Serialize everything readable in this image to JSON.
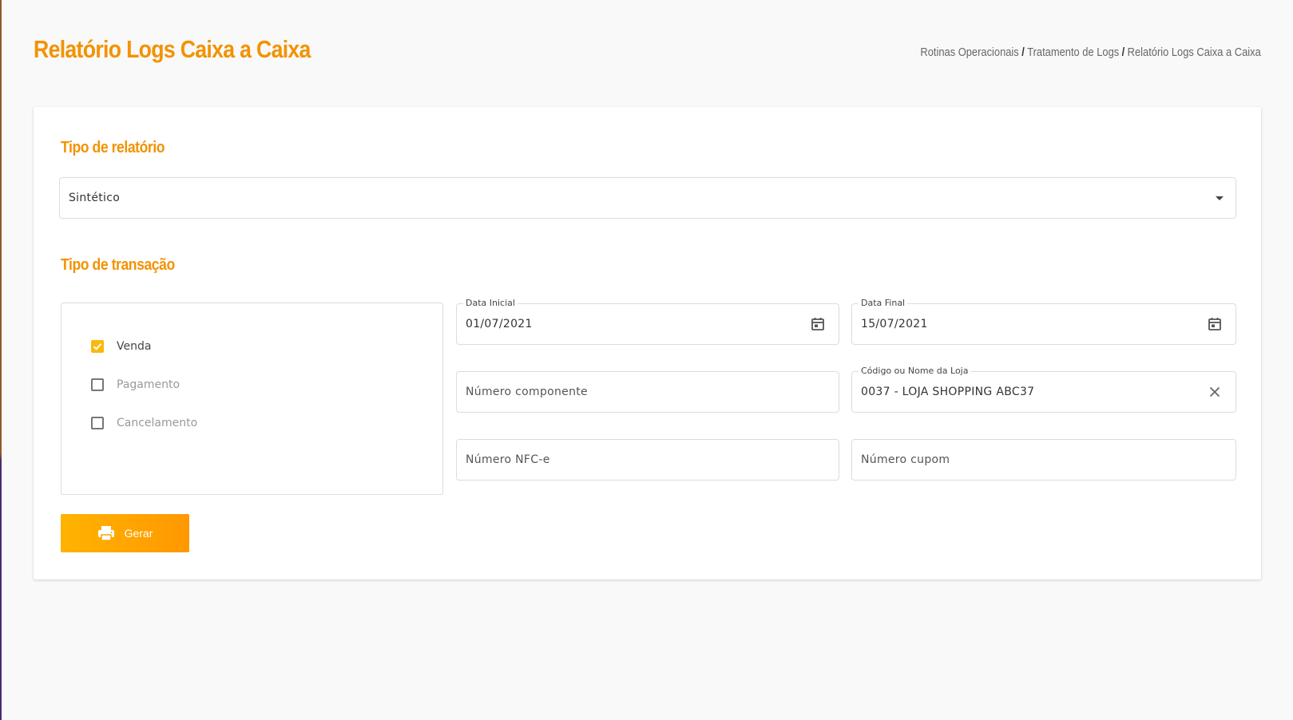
{
  "header": {
    "title": "Relatório Logs Caixa a Caixa",
    "breadcrumb": [
      "Rotinas Operacionais",
      "Tratamento de Logs",
      "Relatório Logs Caixa a Caixa"
    ]
  },
  "report_type": {
    "section_title": "Tipo de relatório",
    "selected": "Sintético"
  },
  "transaction_type": {
    "section_title": "Tipo de transação",
    "options": [
      {
        "label": "Venda",
        "checked": true
      },
      {
        "label": "Pagamento",
        "checked": false
      },
      {
        "label": "Cancelamento",
        "checked": false
      }
    ]
  },
  "filters": {
    "start_date": {
      "label": "Data Inicial",
      "value": "01/07/2021"
    },
    "end_date": {
      "label": "Data Final",
      "value": "15/07/2021"
    },
    "component_number": {
      "placeholder": "Número componente"
    },
    "store": {
      "label": "Código ou Nome da Loja",
      "value": "0037 - LOJA SHOPPING ABC37"
    },
    "nfce_number": {
      "placeholder": "Número NFC-e"
    },
    "coupon_number": {
      "placeholder": "Número cupom"
    }
  },
  "actions": {
    "generate_label": "Gerar",
    "generate_icon": "printer-icon"
  },
  "colors": {
    "accent": "#f39200",
    "checkbox_checked": "#fbb90d",
    "button_gradient_start": "#ffb300",
    "button_gradient_end": "#ff9800"
  }
}
